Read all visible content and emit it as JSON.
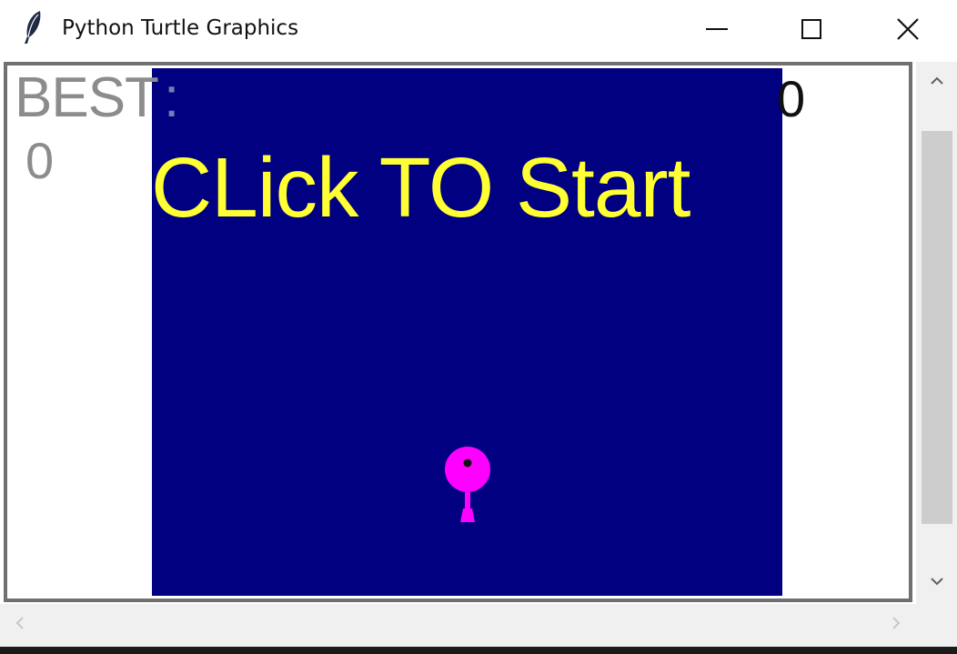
{
  "window": {
    "title": "Python Turtle Graphics",
    "app_icon": "feather-icon",
    "controls": {
      "minimize_icon": "minimize-icon",
      "maximize_icon": "maximize-icon",
      "close_icon": "close-icon"
    }
  },
  "game": {
    "best_label": "BEST",
    "best_colon": ":",
    "best_value": "0",
    "score_value": "0",
    "start_message": "CLick TO Start",
    "colors": {
      "playfield": "#000080",
      "start_text": "#ffff33",
      "balloon": "#ff00ff",
      "best_text": "#8c8c8c",
      "score_text": "#111111"
    }
  },
  "scrollbars": {
    "vertical": {
      "up_icon": "chevron-up-icon",
      "down_icon": "chevron-down-icon"
    },
    "horizontal": {
      "left_icon": "chevron-left-icon",
      "right_icon": "chevron-right-icon"
    }
  }
}
